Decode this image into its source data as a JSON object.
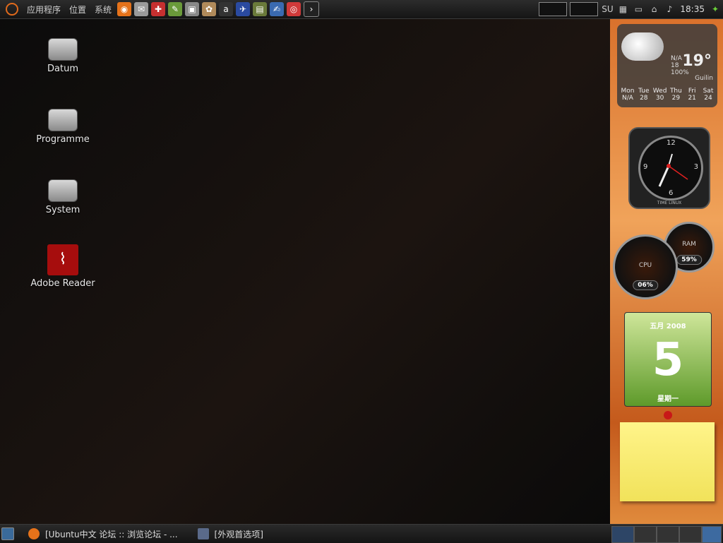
{
  "top_panel": {
    "menus": [
      "应用程序",
      "位置",
      "系统"
    ],
    "launchers": [
      "firefox-icon",
      "mail-icon",
      "help-icon",
      "paint-icon",
      "terminal-window-icon",
      "palette-icon",
      "amarok-icon",
      "plane-icon",
      "books-icon",
      "editor-icon",
      "lifebuoy-icon",
      "terminal-icon"
    ],
    "tray_label": "SU",
    "clock": "18:35"
  },
  "desktop_icons": [
    {
      "label": "Datum"
    },
    {
      "label": "Programme"
    },
    {
      "label": "System"
    },
    {
      "label": "Adobe Reader"
    }
  ],
  "widgets": {
    "weather": {
      "temp": "19°",
      "na": "N/A",
      "hi": "18",
      "humidity": "100%",
      "city": "Guilin",
      "days": [
        {
          "name": "Mon",
          "temp": "N/A"
        },
        {
          "name": "Tue",
          "temp": "28"
        },
        {
          "name": "Wed",
          "temp": "30"
        },
        {
          "name": "Thu",
          "temp": "29"
        },
        {
          "name": "Fri",
          "temp": "21"
        },
        {
          "name": "Sat",
          "temp": "24"
        }
      ]
    },
    "clock": {
      "brand": "TIME LINUX",
      "n12": "12",
      "n3": "3",
      "n6": "6",
      "n9": "9"
    },
    "cpu": {
      "label": "CPU",
      "value": "06%"
    },
    "ram": {
      "label": "RAM",
      "value": "59%"
    },
    "calendar": {
      "month": "五月 2008",
      "day": "5",
      "weekday": "星期一"
    }
  },
  "bottom_panel": {
    "tasks": [
      "[Ubuntu中文 论坛 :: 浏览论坛 - ...",
      "[外观首选项]"
    ]
  },
  "colors": {
    "accent": "#e06a1c",
    "dock": "#d9712c"
  }
}
